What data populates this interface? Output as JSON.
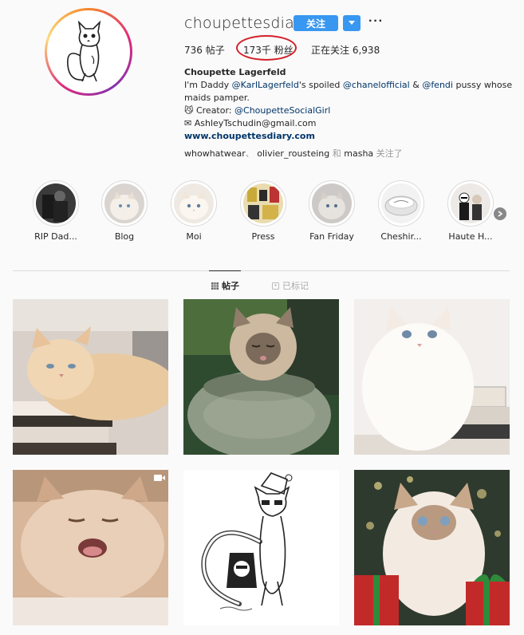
{
  "profile": {
    "username": "choupettesdiary",
    "follow_label": "关注",
    "more_label": "···",
    "posts_count": "736",
    "posts_label": "帖子",
    "followers_count": "173千",
    "followers_label": "粉丝",
    "following_label": "正在关注",
    "following_count": "6,938",
    "full_name": "Choupette Lagerfeld",
    "bio_line1_a": "I'm Daddy ",
    "bio_line1_mention1": "@KarlLagerfeld",
    "bio_line1_b": "'s spoiled ",
    "bio_line1_mention2": "@chanelofficial",
    "bio_line1_c": " & ",
    "bio_line1_mention3": "@fendi",
    "bio_line1_d": " pussy whose",
    "bio_line2": "maids pamper.",
    "bio_line3_prefix": "😼 Creator: ",
    "bio_line3_mention": "@ChoupetteSocialGirl",
    "bio_line4": "✉ AshleyTschudin@gmail.com",
    "website": "www.choupettesdiary.com",
    "followed_by_1": "whowhatwear",
    "followed_by_sep": "、",
    "followed_by_2": "olivier_rousteing",
    "followed_by_and": "和",
    "followed_by_3": "masha",
    "followed_by_suffix": "关注了"
  },
  "highlights": [
    {
      "label": "RIP Dad..."
    },
    {
      "label": "Blog"
    },
    {
      "label": "Moi"
    },
    {
      "label": "Press"
    },
    {
      "label": "Fan Friday"
    },
    {
      "label": "Cheshir..."
    },
    {
      "label": "Haute H..."
    }
  ],
  "tabs": [
    {
      "label": "帖子",
      "icon": "grid-icon",
      "active": true
    },
    {
      "label": "已标记",
      "icon": "tag-icon",
      "active": false
    }
  ],
  "colors": {
    "accent": "#3897f0",
    "highlight_circle": "#d4202a",
    "link": "#003569"
  }
}
